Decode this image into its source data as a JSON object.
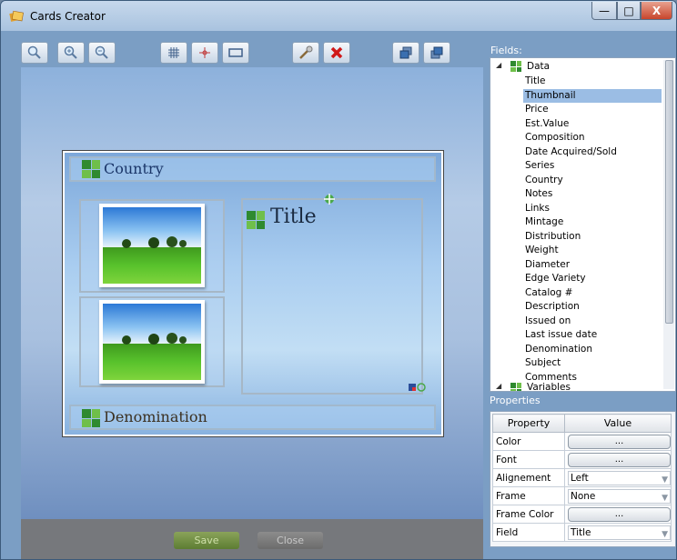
{
  "window": {
    "title": "Cards Creator",
    "min": "—",
    "max": "□",
    "close": "X"
  },
  "toolbar": {
    "icons": [
      "zoom-icon",
      "zoom-in-icon",
      "zoom-out-icon",
      "grid-icon",
      "target-icon",
      "frame-icon",
      "tools-icon",
      "delete-icon",
      "bring-front-icon",
      "send-back-icon"
    ]
  },
  "card": {
    "top_field": "Country",
    "title_field": "Title",
    "bottom_field": "Denomination"
  },
  "buttons": {
    "save": "Save",
    "close": "Close"
  },
  "fields": {
    "label": "Fields:",
    "group": "Data",
    "items": [
      "Title",
      "Thumbnail",
      "Price",
      "Est.Value",
      "Composition",
      "Date Acquired/Sold",
      "Series",
      "Country",
      "Notes",
      "Links",
      "Mintage",
      "Distribution",
      "Weight",
      "Diameter",
      "Edge Variety",
      "Catalog #",
      "Description",
      "Issued on",
      "Last issue date",
      "Denomination",
      "Subject",
      "Comments"
    ],
    "selected": "Thumbnail",
    "group2": "Variables"
  },
  "properties": {
    "label": "Properties",
    "headers": [
      "Property",
      "Value"
    ],
    "rows": [
      {
        "name": "Color",
        "value": "..."
      },
      {
        "name": "Font",
        "value": "..."
      },
      {
        "name": "Alignement",
        "value": "Left"
      },
      {
        "name": "Frame",
        "value": "None"
      },
      {
        "name": "Frame Color",
        "value": "..."
      },
      {
        "name": "Field",
        "value": "Title"
      }
    ]
  },
  "colors": {
    "accent": "#9bbde4",
    "save_button": "#6f8f40",
    "grid_icon": "#2f8a2f"
  }
}
